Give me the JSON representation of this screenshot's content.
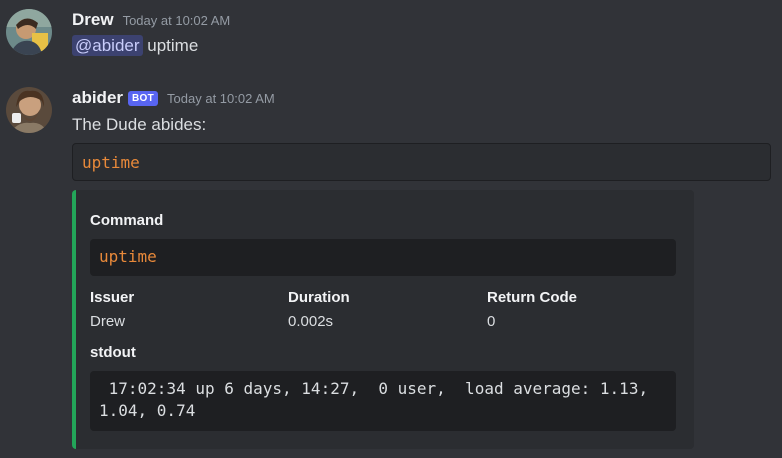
{
  "messages": [
    {
      "username": "Drew",
      "timestamp": "Today at 10:02 AM",
      "mention": "@abider",
      "text": "uptime"
    },
    {
      "username": "abider",
      "bot_tag": "BOT",
      "timestamp": "Today at 10:02 AM",
      "text": "The Dude abides:",
      "code": "uptime",
      "embed": {
        "accent_color": "#23a559",
        "command_title": "Command",
        "command_value": "uptime",
        "fields": [
          {
            "title": "Issuer",
            "value": "Drew"
          },
          {
            "title": "Duration",
            "value": "0.002s"
          },
          {
            "title": "Return Code",
            "value": "0"
          }
        ],
        "stdout_title": "stdout",
        "stdout_value": " 17:02:34 up 6 days, 14:27,  0 user,  load average: 1.13, 1.04, 0.74"
      }
    }
  ]
}
